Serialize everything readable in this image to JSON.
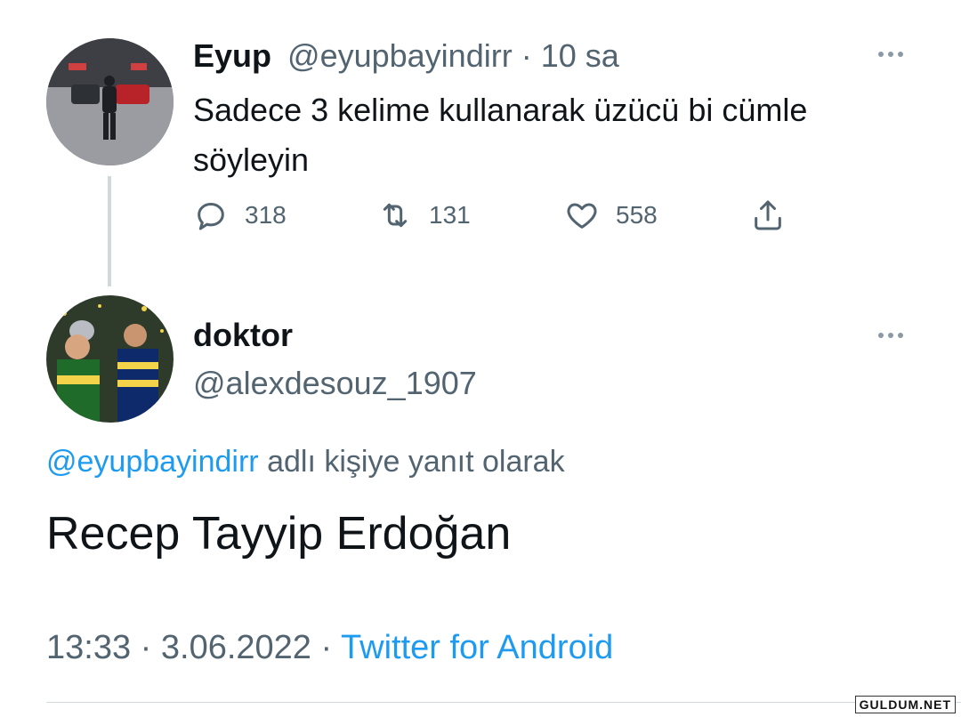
{
  "original_tweet": {
    "display_name": "Eyup",
    "handle": "@eyupbayindirr",
    "separator": "·",
    "time": "10 sa",
    "text_line1": "Sadece 3 kelime kullanarak üzücü bi cümle",
    "text_line2": "söyleyin",
    "replies": "318",
    "retweets": "131",
    "likes": "558"
  },
  "reply_tweet": {
    "display_name": "doktor",
    "handle": "@alexdesouz_1907",
    "reply_to_handle": "@eyupbayindirr",
    "reply_to_suffix": "adlı kişiye yanıt olarak",
    "text": "Recep Tayyip Erdoğan",
    "time": "13:33",
    "separator1": "·",
    "date": "3.06.2022",
    "separator2": "·",
    "source": "Twitter for Android"
  },
  "watermark": "GULDUM.NET",
  "colors": {
    "link": "#1d9bf0",
    "muted": "#536471",
    "text": "#0f1419",
    "thread_line": "#cfd9de"
  },
  "icons": [
    "reply-icon",
    "retweet-icon",
    "like-icon",
    "share-icon",
    "more-icon"
  ]
}
